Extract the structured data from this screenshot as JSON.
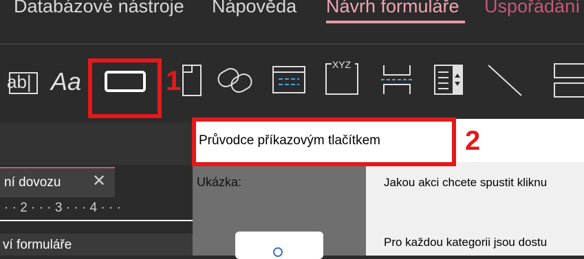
{
  "ribbon": {
    "tabs": [
      {
        "label": "Databázové nástroje"
      },
      {
        "label": "Nápověda"
      },
      {
        "label": "Návrh formuláře"
      },
      {
        "label": "Uspořádání"
      }
    ],
    "controls": [
      {
        "icon": "text-box-icon",
        "label": "ab|"
      },
      {
        "icon": "label-icon",
        "label": "Aa"
      },
      {
        "icon": "button-control-icon"
      },
      {
        "icon": "tab-control-icon"
      },
      {
        "icon": "hyperlink-icon"
      },
      {
        "icon": "web-browser-control-icon"
      },
      {
        "icon": "navigation-control-icon",
        "label": "XYZ"
      },
      {
        "icon": "page-break-icon"
      },
      {
        "icon": "combo-box-icon"
      },
      {
        "icon": "line-icon"
      },
      {
        "icon": "rectangle-icon"
      }
    ]
  },
  "left_panel": {
    "doc_tab_label": "ní dovozu",
    "ruler_text": "· · 2 · · · 3 · · · 4 · · ·",
    "form_label": "ví formuláře"
  },
  "dialog": {
    "title": "Průvodce příkazovým tlačítkem",
    "sample_label": "Ukázka:",
    "line1": "Jakou akci chcete spustit kliknu",
    "line2": "Pro každou kategorii jsou dostu"
  },
  "annotations": {
    "marker1": "1",
    "marker2": "2"
  },
  "colors": {
    "ribbon_bg": "#2b2b2b",
    "active_tab": "#f0a3b4",
    "annotation_red": "#e3191b",
    "accent_blue": "#4aa0e6"
  }
}
